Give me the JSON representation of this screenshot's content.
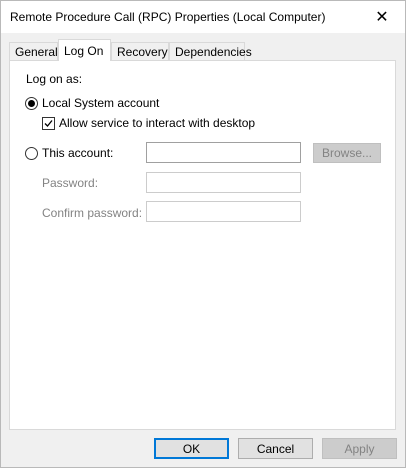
{
  "window": {
    "title": "Remote Procedure Call (RPC) Properties (Local Computer)",
    "close_glyph": "✕"
  },
  "tabs": [
    {
      "label": "General"
    },
    {
      "label": "Log On"
    },
    {
      "label": "Recovery"
    },
    {
      "label": "Dependencies"
    }
  ],
  "logon": {
    "heading": "Log on as:",
    "local_system_label": "Local System account",
    "interact_desktop_label": "Allow service to interact with desktop",
    "this_account_label": "This account:",
    "account_value": "",
    "browse_label": "Browse...",
    "password_label": "Password:",
    "password_value": "",
    "confirm_label": "Confirm password:",
    "confirm_value": ""
  },
  "buttons": {
    "ok": "OK",
    "cancel": "Cancel",
    "apply": "Apply"
  }
}
